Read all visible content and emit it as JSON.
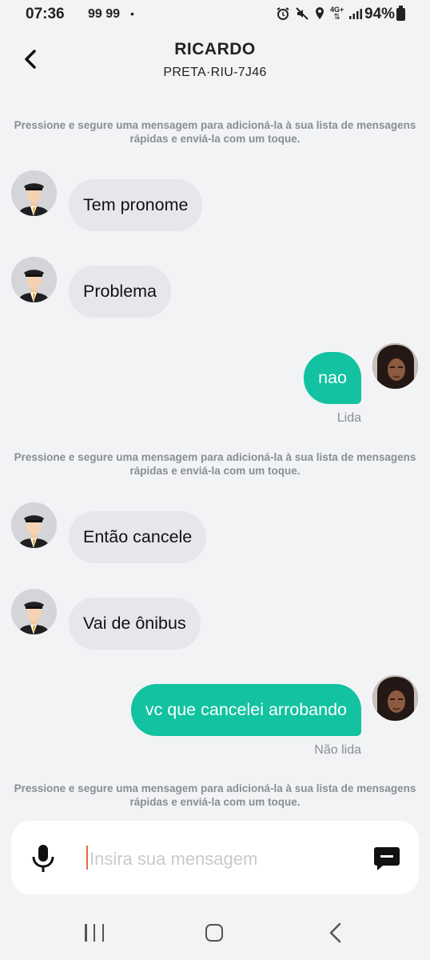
{
  "status_bar": {
    "time": "07:36",
    "network_tag": "99 99",
    "dot": "•",
    "signal_label": "4G+",
    "battery": "94%"
  },
  "header": {
    "driver_name": "RICARDO",
    "plate": "PRETA·RIU-7J46",
    "back_icon": "chevron-left-icon"
  },
  "hint_text": "Pressione e segure uma mensagem para adicioná-la à sua lista de mensagens rápidas e enviá-la com um toque.",
  "messages": [
    {
      "from": "driver",
      "text": "Tem pronome"
    },
    {
      "from": "driver",
      "text": "Problema"
    },
    {
      "from": "user",
      "text": "nao",
      "status": "Lida"
    },
    {
      "from": "driver",
      "text": "Então cancele"
    },
    {
      "from": "driver",
      "text": "Vai de ônibus"
    },
    {
      "from": "user",
      "text": "vc que cancelei arrobando",
      "status": "Não lida"
    }
  ],
  "composer": {
    "placeholder": "Insira sua mensagem",
    "value": "",
    "mic_icon": "microphone-icon",
    "send_icon": "message-send-icon"
  },
  "colors": {
    "accent": "#12c2a0",
    "incoming_bubble": "#e6e7eb",
    "background": "#f2f3f5",
    "caret": "#e36d3d"
  },
  "navbar": {
    "icons": [
      "recents-icon",
      "home-icon",
      "back-icon"
    ]
  }
}
